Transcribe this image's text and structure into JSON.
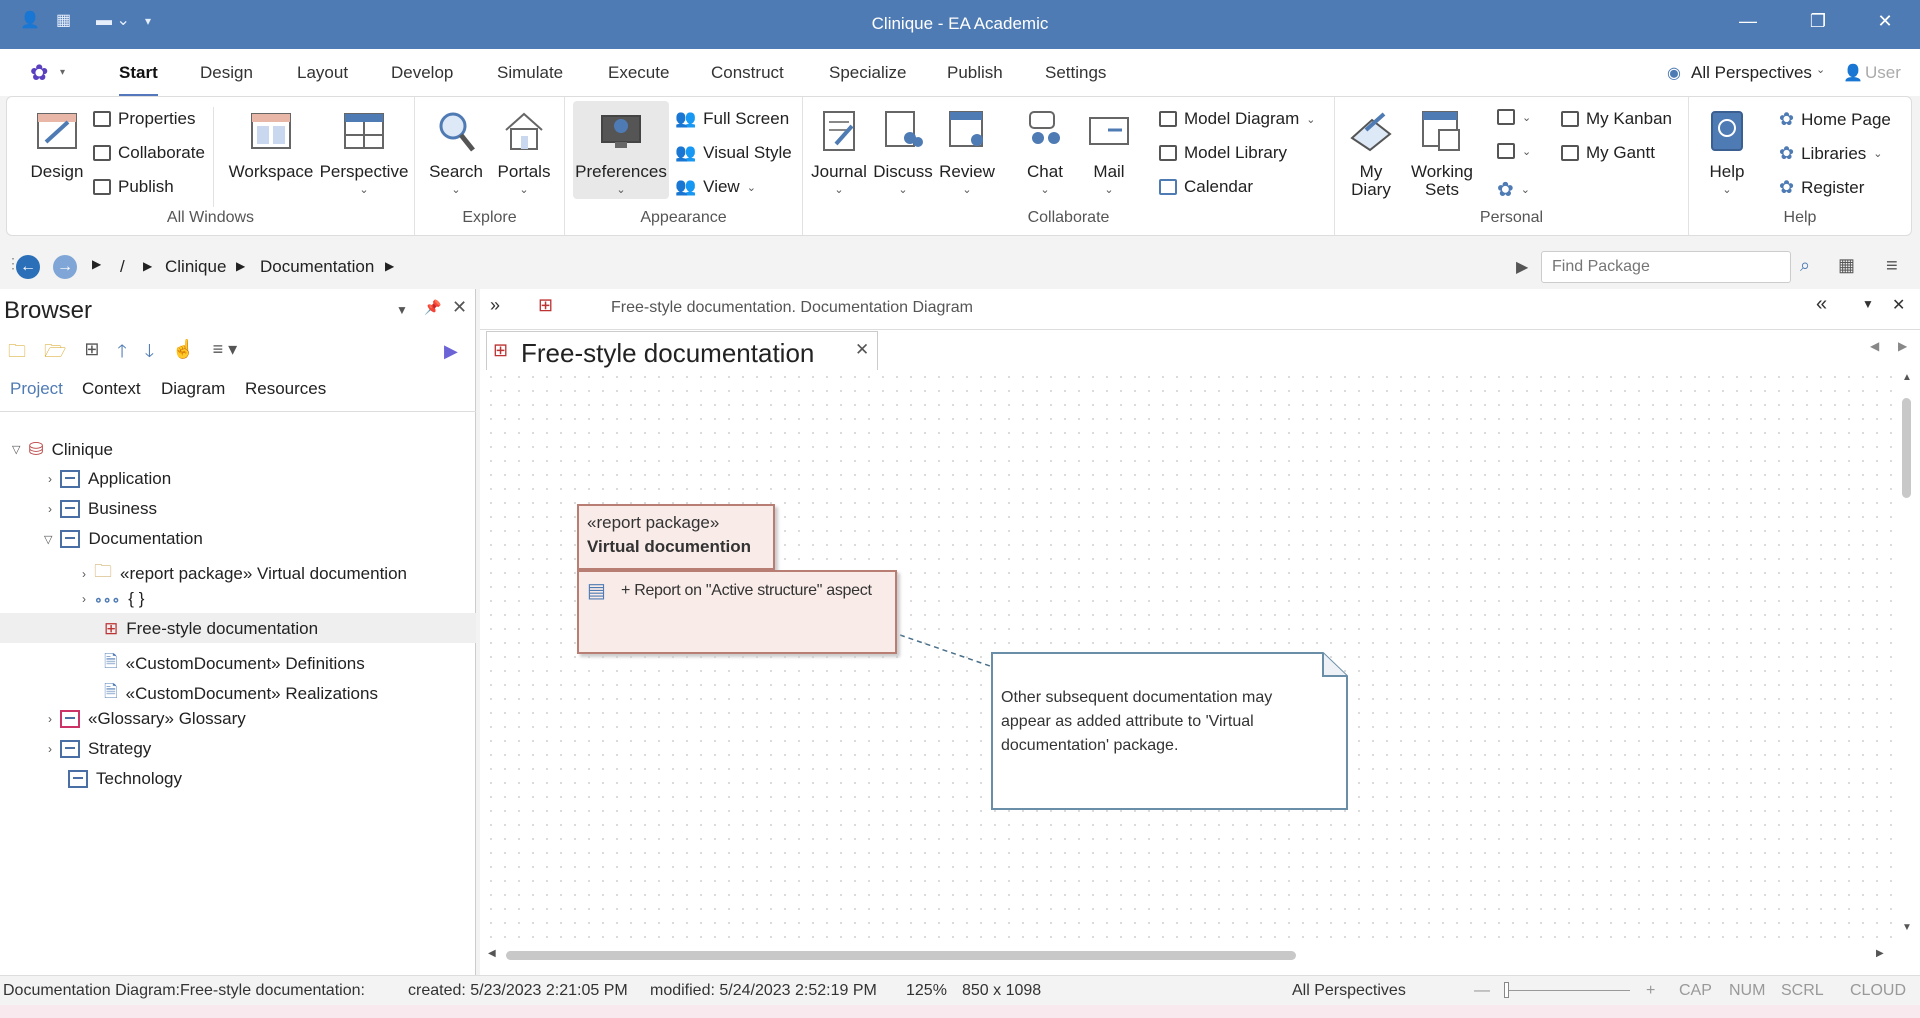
{
  "window": {
    "title": "Clinique - EA Academic"
  },
  "menu": {
    "tabs": [
      "Start",
      "Design",
      "Layout",
      "Develop",
      "Simulate",
      "Execute",
      "Construct",
      "Specialize",
      "Publish",
      "Settings"
    ],
    "perspectives": "All Perspectives",
    "user": "User"
  },
  "ribbon": {
    "all_windows": {
      "label": "All Windows",
      "design": "Design",
      "properties": "Properties",
      "collaborate": "Collaborate",
      "publish": "Publish",
      "workspace": "Workspace",
      "perspective": "Perspective"
    },
    "explore": {
      "label": "Explore",
      "search": "Search",
      "portals": "Portals"
    },
    "appearance": {
      "label": "Appearance",
      "preferences": "Preferences",
      "full_screen": "Full Screen",
      "visual_style": "Visual Style",
      "view": "View"
    },
    "collaborate": {
      "label": "Collaborate",
      "journal": "Journal",
      "discuss": "Discuss",
      "review": "Review",
      "chat": "Chat",
      "mail": "Mail",
      "model_diagram": "Model Diagram",
      "model_library": "Model Library",
      "calendar": "Calendar"
    },
    "personal": {
      "label": "Personal",
      "my_diary_1": "My",
      "my_diary_2": "Diary",
      "working_sets_1": "Working",
      "working_sets_2": "Sets",
      "my_kanban": "My Kanban",
      "my_gantt": "My Gantt"
    },
    "help": {
      "label": "Help",
      "help": "Help",
      "home_page": "Home Page",
      "libraries": "Libraries",
      "register": "Register"
    }
  },
  "address": {
    "root": "/",
    "crumbs": [
      "Clinique",
      "Documentation"
    ],
    "find_placeholder": "Find Package"
  },
  "browser": {
    "title": "Browser",
    "tabs": [
      "Project",
      "Context",
      "Diagram",
      "Resources"
    ],
    "tree": [
      "Clinique",
      "Application",
      "Business",
      "Documentation",
      "«report package» Virtual documention",
      "{ }",
      "Free-style documentation",
      "«CustomDocument» Definitions",
      "«CustomDocument» Realizations",
      "«Glossary» Glossary",
      "Strategy",
      "Technology"
    ]
  },
  "diagram": {
    "header": "Free-style documentation.  Documentation Diagram",
    "tab": "Free-style documentation",
    "package": {
      "stereotype": "«report package»",
      "name": "Virtual documention",
      "attribute": "+ Report on \"Active structure\" aspect"
    },
    "note": "Other subsequent documentation may appear as added attribute to 'Virtual documentation' package."
  },
  "status": {
    "diagram": "Documentation Diagram:Free-style documentation:",
    "created": "created: 5/23/2023 2:21:05 PM",
    "modified": "modified: 5/24/2023 2:52:19 PM",
    "zoom": "125%",
    "size": "850 x 1098",
    "perspectives": "All Perspectives",
    "minus": "—",
    "plus": "+",
    "cap": "CAP",
    "num": "NUM",
    "scrl": "SCRL",
    "cloud": "CLOUD"
  },
  "colors": {
    "titlebar": "#4f7bb4",
    "accent": "#5577bb",
    "package_fill": "#f9ebe8"
  }
}
